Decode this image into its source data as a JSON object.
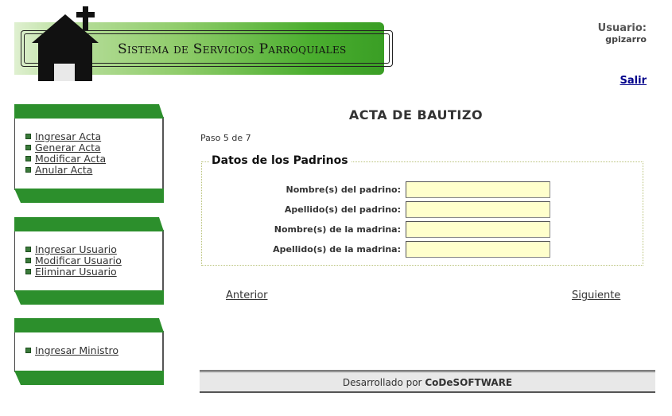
{
  "header": {
    "system_title": "Sistema de Servicios Parroquiales",
    "user_label": "Usuario:",
    "username": "gpizarro",
    "logout_label": "Salir"
  },
  "menus": {
    "actas": [
      "Ingresar Acta",
      "Generar Acta",
      "Modificar Acta",
      "Anular Acta"
    ],
    "usuarios": [
      "Ingresar Usuario",
      "Modificar Usuario",
      "Eliminar Usuario"
    ],
    "ministros": [
      "Ingresar Ministro"
    ]
  },
  "main": {
    "title": "ACTA DE BAUTIZO",
    "step": "Paso 5 de 7",
    "section_title": "Datos de los Padrinos",
    "fields": [
      {
        "label": "Nombre(s) del padrino:",
        "value": ""
      },
      {
        "label": "Apellido(s) del padrino:",
        "value": ""
      },
      {
        "label": "Nombre(s) de la madrina:",
        "value": ""
      },
      {
        "label": "Apellido(s) de la madrina:",
        "value": ""
      }
    ],
    "prev_label": "Anterior",
    "next_label": "Siguiente"
  },
  "footer": {
    "prefix": "Desarrollado por",
    "company": "CoDeSOFTWARE"
  },
  "colors": {
    "menu_green": "#2c8f2c",
    "input_bg": "#ffffcc",
    "link_blue": "#00008b"
  }
}
